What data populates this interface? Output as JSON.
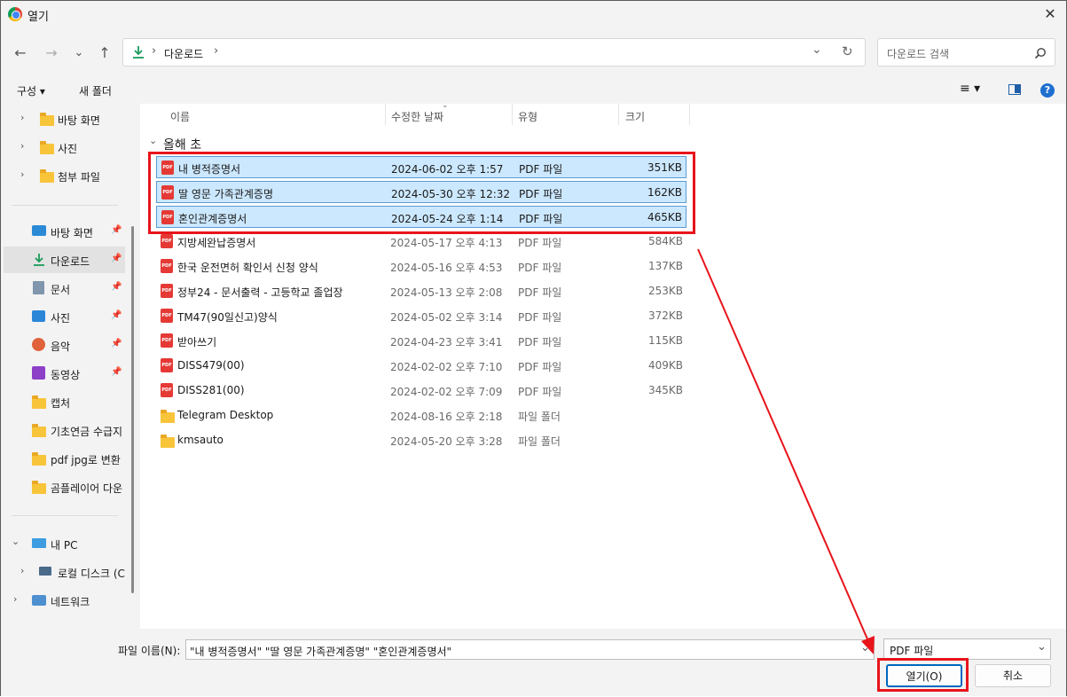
{
  "window": {
    "title": "열기",
    "close_label": "✕"
  },
  "nav": {
    "back": "←",
    "forward": "→",
    "recent": "⌄",
    "up": "↑"
  },
  "address": {
    "path_item": "다운로드",
    "sep1": "›",
    "sep2": "›",
    "dropdown": "⌄",
    "refresh": "↻"
  },
  "search": {
    "placeholder": "다운로드 검색"
  },
  "toolbar": {
    "organize": "구성 ▾",
    "new_folder": "새 폴더",
    "view": "≡ ▾"
  },
  "sidebar": {
    "top": [
      {
        "label": "바탕 화면"
      },
      {
        "label": "사진"
      },
      {
        "label": "첨부 파일"
      }
    ],
    "quick": [
      {
        "label": "바탕 화면"
      },
      {
        "label": "다운로드"
      },
      {
        "label": "문서"
      },
      {
        "label": "사진"
      },
      {
        "label": "음악"
      },
      {
        "label": "동영상"
      },
      {
        "label": "캡처"
      },
      {
        "label": "기초연금 수급지"
      },
      {
        "label": "pdf jpg로 변환"
      },
      {
        "label": "곰플레이어 다운"
      }
    ],
    "pc": "내 PC",
    "disk": "로컬 디스크 (C",
    "network": "네트워크"
  },
  "columns": {
    "name": "이름",
    "date": "수정한 날짜",
    "type": "유형",
    "size": "크기"
  },
  "group": {
    "label": "올해 초"
  },
  "files": [
    {
      "name": "내 병적증명서",
      "date": "2024-06-02 오후 1:57",
      "type": "PDF 파일",
      "size": "351KB"
    },
    {
      "name": "딸 영문 가족관계증명",
      "date": "2024-05-30 오후 12:32",
      "type": "PDF 파일",
      "size": "162KB"
    },
    {
      "name": "혼인관계증명서",
      "date": "2024-05-24 오후 1:14",
      "type": "PDF 파일",
      "size": "465KB"
    },
    {
      "name": "지방세완납증명서",
      "date": "2024-05-17 오후 4:13",
      "type": "PDF 파일",
      "size": "584KB"
    },
    {
      "name": "한국 운전면허 확인서 신청 양식",
      "date": "2024-05-16 오후 4:53",
      "type": "PDF 파일",
      "size": "137KB"
    },
    {
      "name": "정부24 - 문서출력 - 고등학교 졸업장",
      "date": "2024-05-13 오후 2:08",
      "type": "PDF 파일",
      "size": "253KB"
    },
    {
      "name": "TM47(90일신고)양식",
      "date": "2024-05-02 오후 3:14",
      "type": "PDF 파일",
      "size": "372KB"
    },
    {
      "name": "받아쓰기",
      "date": "2024-04-23 오후 3:41",
      "type": "PDF 파일",
      "size": "115KB"
    },
    {
      "name": "DISS479(00)",
      "date": "2024-02-02 오후 7:10",
      "type": "PDF 파일",
      "size": "409KB"
    },
    {
      "name": "DISS281(00)",
      "date": "2024-02-02 오후 7:09",
      "type": "PDF 파일",
      "size": "345KB"
    },
    {
      "name": "Telegram Desktop",
      "date": "2024-08-16 오후 2:18",
      "type": "파일 폴더",
      "size": ""
    },
    {
      "name": "kmsauto",
      "date": "2024-05-20 오후 3:28",
      "type": "파일 폴더",
      "size": ""
    }
  ],
  "bottom": {
    "filename_label": "파일 이름(N):",
    "filename_value": "\"내 병적증명서\" \"딸 영문 가족관계증명\" \"혼인관계증명서\"",
    "filetype_value": "PDF 파일",
    "open_label": "열기(O)",
    "cancel_label": "취소"
  },
  "colors": {
    "annotation": "#e8141b",
    "selection": "#cce8ff"
  }
}
